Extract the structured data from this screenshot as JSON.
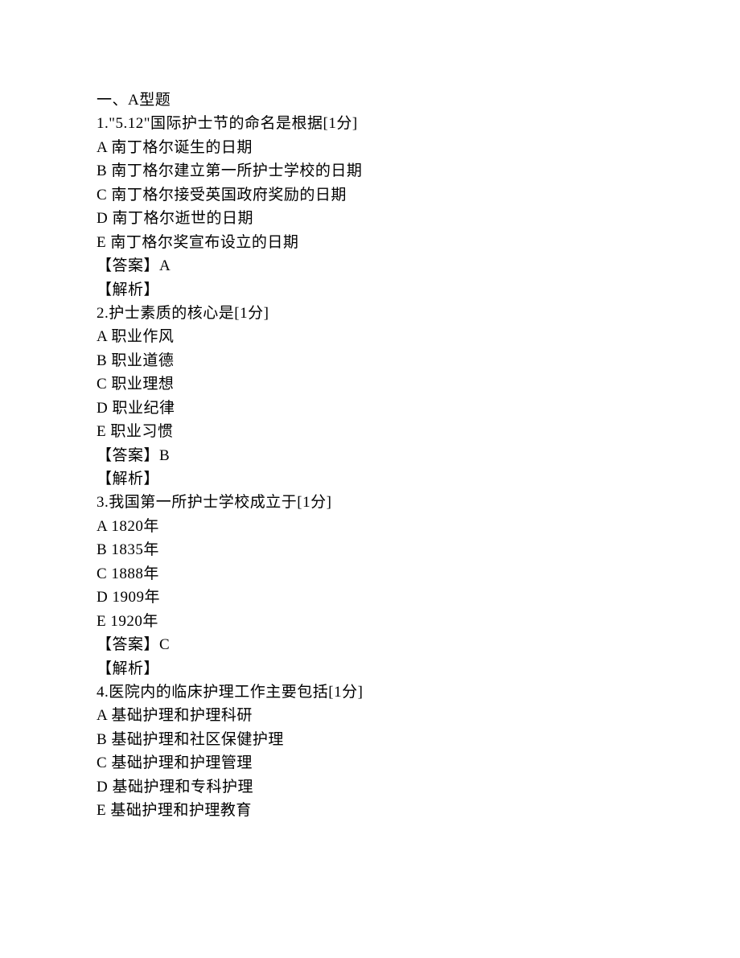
{
  "section_header": "一、A型题",
  "questions": [
    {
      "stem": "1.\"5.12\"国际护士节的命名是根据[1分]",
      "options": [
        "A 南丁格尔诞生的日期",
        "B 南丁格尔建立第一所护士学校的日期",
        "C 南丁格尔接受英国政府奖励的日期",
        "D 南丁格尔逝世的日期",
        "E 南丁格尔奖宣布设立的日期"
      ],
      "answer": "【答案】A",
      "analysis": "【解析】"
    },
    {
      "stem": "2.护士素质的核心是[1分]",
      "options": [
        "A 职业作风",
        "B 职业道德",
        "C 职业理想",
        "D 职业纪律",
        "E 职业习惯"
      ],
      "answer": "【答案】B",
      "analysis": "【解析】"
    },
    {
      "stem": "3.我国第一所护士学校成立于[1分]",
      "options": [
        "A 1820年",
        "B 1835年",
        "C 1888年",
        "D 1909年",
        "E 1920年"
      ],
      "answer": "【答案】C",
      "analysis": "【解析】"
    },
    {
      "stem": "4.医院内的临床护理工作主要包括[1分]",
      "options": [
        "A 基础护理和护理科研",
        "B 基础护理和社区保健护理",
        "C 基础护理和护理管理",
        "D 基础护理和专科护理",
        "E 基础护理和护理教育"
      ]
    }
  ]
}
